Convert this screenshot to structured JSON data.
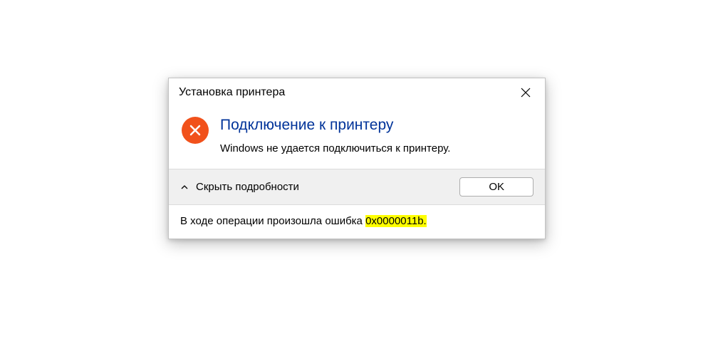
{
  "dialog": {
    "title": "Установка принтера",
    "heading": "Подключение к принтеру",
    "message": "Windows не удается подключиться к принтеру.",
    "details_toggle": "Скрыть подробности",
    "ok_button": "OK",
    "details_prefix": "В ходе операции произошла ошибка ",
    "error_code": "0x0000011b",
    "details_suffix": "."
  },
  "icons": {
    "close": "close-icon",
    "error": "error-x-icon",
    "chevron": "chevron-up-icon"
  },
  "colors": {
    "heading": "#003399",
    "error_bg": "#f1511b",
    "footer_bg": "#f0f0f0",
    "highlight": "#ffff00"
  }
}
